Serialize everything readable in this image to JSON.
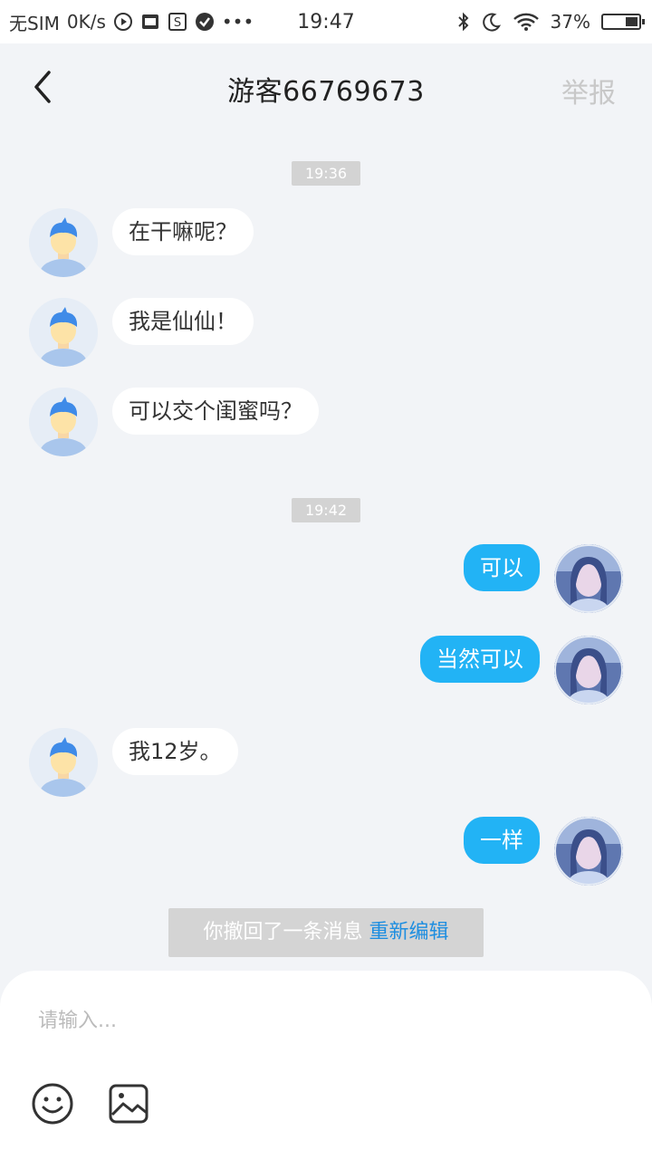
{
  "status_bar": {
    "sim": "无SIM",
    "speed": "0K/s",
    "dots": "•••",
    "time": "19:47",
    "battery": "37%",
    "battery_level": 0.37
  },
  "header": {
    "title": "游客66769673",
    "report_label": "举报"
  },
  "messages": [
    {
      "type": "time",
      "text": "19:36"
    },
    {
      "type": "incoming",
      "text": "在干嘛呢？"
    },
    {
      "type": "incoming",
      "text": "我是仙仙！"
    },
    {
      "type": "incoming",
      "text": "可以交个闺蜜吗？"
    },
    {
      "type": "time",
      "text": "19:42"
    },
    {
      "type": "outgoing",
      "text": "可以"
    },
    {
      "type": "outgoing",
      "text": "当然可以"
    },
    {
      "type": "incoming",
      "text": "我12岁。"
    },
    {
      "type": "outgoing",
      "text": "一样"
    }
  ],
  "recall": {
    "text": "你撤回了一条消息",
    "edit_label": "重新编辑"
  },
  "composer": {
    "placeholder": "请输入..."
  },
  "colors": {
    "accent": "#22b3f5",
    "link": "#1e8ee0",
    "background": "#f2f4f7"
  }
}
